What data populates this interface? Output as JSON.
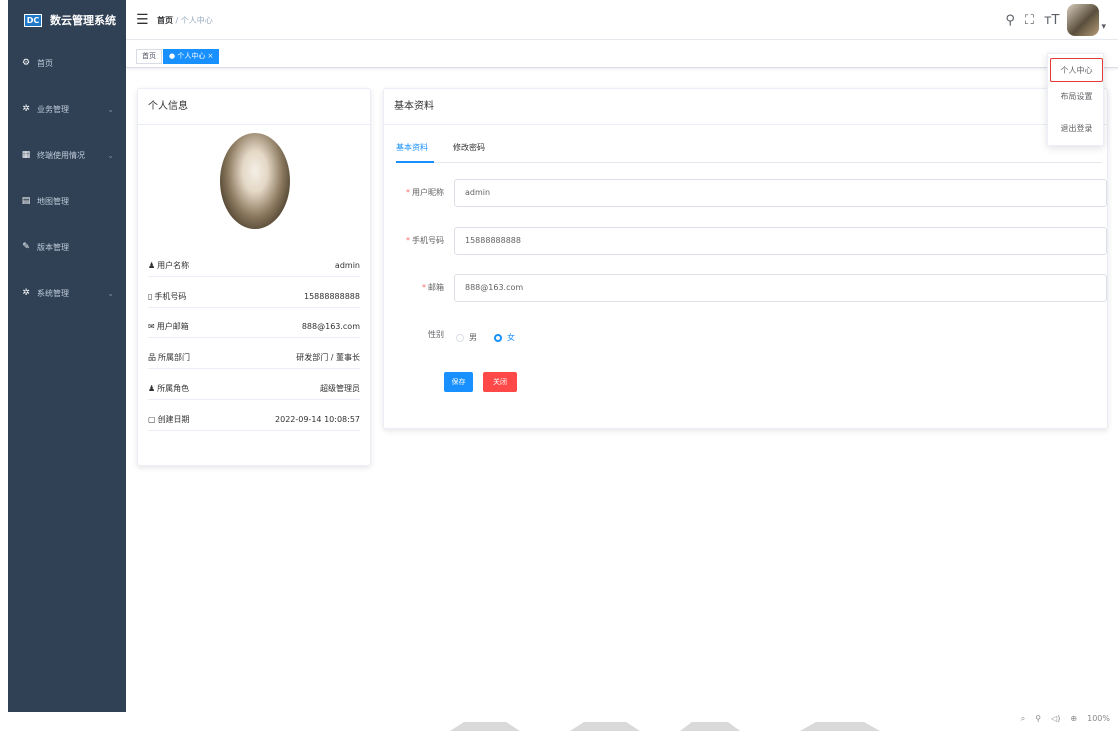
{
  "app": {
    "logo_mark": "DC",
    "title": "数云管理系统"
  },
  "sidebar": {
    "items": [
      {
        "icon": "dashboard-icon",
        "glyph": "⚙",
        "label": "首页",
        "has_children": false
      },
      {
        "icon": "gear-icon",
        "glyph": "✲",
        "label": "业务管理",
        "has_children": true
      },
      {
        "icon": "chart-icon",
        "glyph": "▦",
        "label": "终端使用情况",
        "has_children": true
      },
      {
        "icon": "map-icon",
        "glyph": "▤",
        "label": "地图管理",
        "has_children": false
      },
      {
        "icon": "edit-icon",
        "glyph": "✎",
        "label": "版本管理",
        "has_children": false
      },
      {
        "icon": "gear-icon",
        "glyph": "✲",
        "label": "系统管理",
        "has_children": true
      }
    ],
    "arrow_glyph": "⌄"
  },
  "navbar": {
    "hamburger_glyph": "☰",
    "breadcrumb": {
      "home": "首页",
      "sep": " / ",
      "current": "个人中心"
    },
    "icons": {
      "search": "⚲",
      "fullscreen": "⛶",
      "font_size": "тT"
    },
    "caret": "▾"
  },
  "tags": {
    "home": "首页",
    "active": "● 个人中心 ×"
  },
  "dropdown": {
    "items": [
      "个人中心",
      "布局设置",
      "退出登录"
    ],
    "selected_index": 0
  },
  "profile_card": {
    "title": "个人信息",
    "rows": [
      {
        "icon": "user-icon",
        "glyph": "♟",
        "label": "用户名称",
        "value": "admin"
      },
      {
        "icon": "phone-icon",
        "glyph": "▯",
        "label": "手机号码",
        "value": "15888888888"
      },
      {
        "icon": "email-icon",
        "glyph": "✉",
        "label": "用户邮箱",
        "value": "888@163.com"
      },
      {
        "icon": "tree-icon",
        "glyph": "品",
        "label": "所属部门",
        "value": "研发部门 / 董事长"
      },
      {
        "icon": "peoples-icon",
        "glyph": "♟",
        "label": "所属角色",
        "value": "超级管理员"
      },
      {
        "icon": "date-icon",
        "glyph": "▢",
        "label": "创建日期",
        "value": "2022-09-14 10:08:57"
      }
    ]
  },
  "basic_card": {
    "title": "基本资料",
    "tabs": [
      "基本资料",
      "修改密码"
    ],
    "active_tab": 0,
    "form": {
      "nickname_label": "用户昵称",
      "nickname": "admin",
      "phone_label": "手机号码",
      "phone": "15888888888",
      "email_label": "邮箱",
      "email": "888@163.com",
      "gender_label": "性别",
      "gender_options": [
        "男",
        "女"
      ],
      "gender_selected": 1,
      "required_mark": "*"
    },
    "buttons": {
      "save": "保存",
      "close": "关闭"
    }
  },
  "colors": {
    "primary": "#1890ff",
    "danger": "#ff4949",
    "sidebar_bg": "#304156",
    "highlight_border": "#e53935"
  },
  "statusbar": {
    "items": [
      "⌕",
      "⚲",
      "◁)",
      "⊕",
      "100%"
    ]
  }
}
